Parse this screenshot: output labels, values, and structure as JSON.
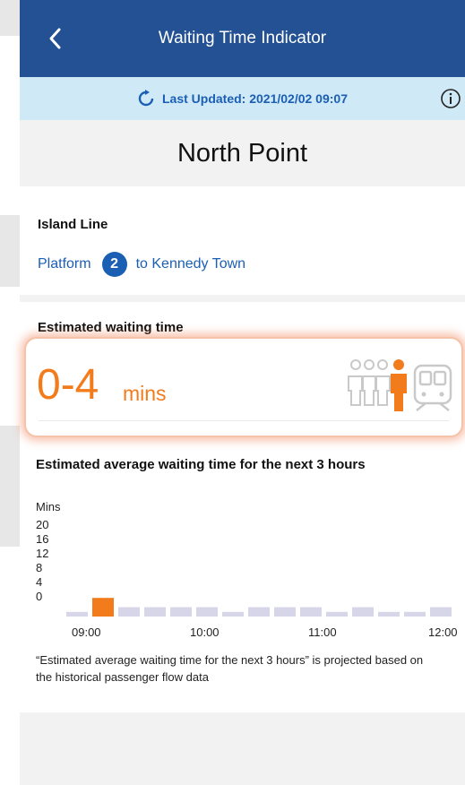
{
  "header": {
    "title": "Waiting Time Indicator"
  },
  "update_bar": {
    "label": "Last Updated: 2021/02/02 09:07"
  },
  "station": {
    "name": "North Point"
  },
  "line": {
    "name": "Island Line",
    "platform_label": "Platform",
    "platform_number": "2",
    "destination": "to Kennedy Town"
  },
  "estimate": {
    "label": "Estimated waiting time",
    "value": "0-4",
    "unit": "mins"
  },
  "forecast": {
    "title": "Estimated average waiting time for the next 3 hours",
    "note": "“Estimated average waiting time for the next 3 hours” is projected based on the historical passenger flow data"
  },
  "chart_data": {
    "type": "bar",
    "ylabel": "Mins",
    "yticks": [
      "20",
      "16",
      "12",
      "8",
      "4",
      "0"
    ],
    "ylim": [
      0,
      20
    ],
    "xticks": [
      "09:00",
      "10:00",
      "11:00",
      "12:00"
    ],
    "values": [
      1,
      4,
      2,
      2,
      2,
      2,
      1,
      2,
      2,
      2,
      1,
      2,
      1,
      1,
      2
    ],
    "highlight_index": 1,
    "colors": {
      "bar": "#d6d6e8",
      "highlight": "#f27c1c"
    }
  },
  "colors": {
    "navbar": "#235193",
    "accent_blue": "#1b5fb4",
    "accent_orange": "#f27c1c"
  }
}
